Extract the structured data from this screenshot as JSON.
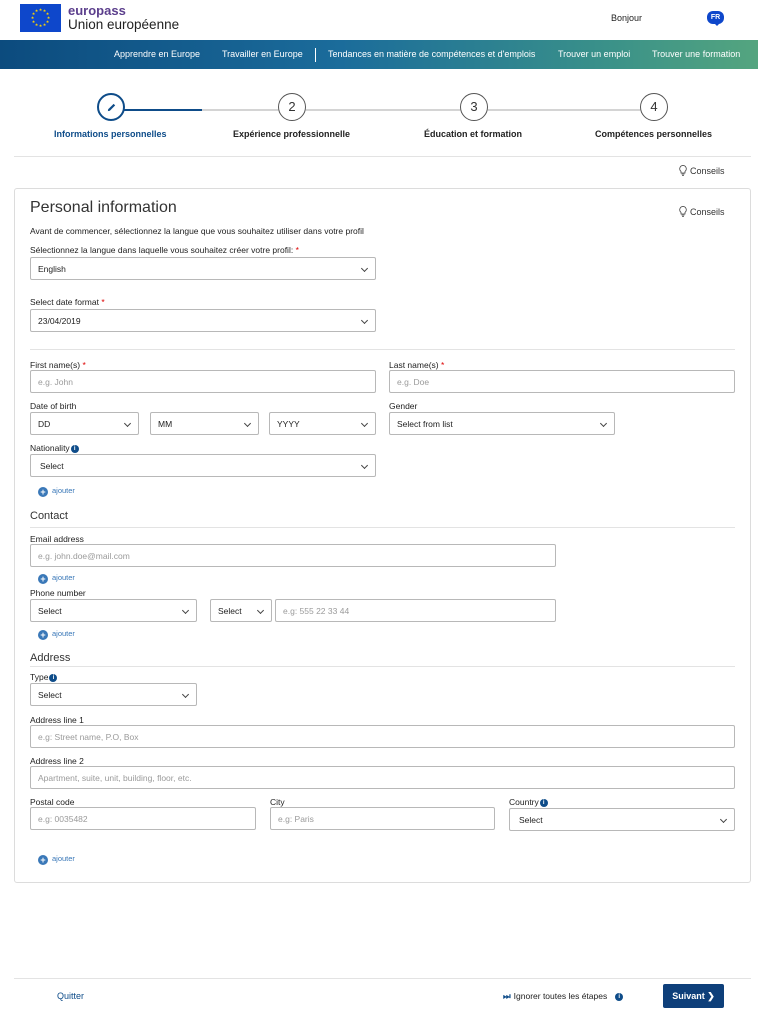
{
  "header": {
    "brand_top": "europass",
    "brand_bottom": "Union européenne",
    "greeting": "Bonjour",
    "language_badge": "FR",
    "logo_icon": "eu-flag-icon"
  },
  "nav": {
    "items": [
      "Apprendre en Europe",
      "Travailler en Europe",
      "Tendances en matière de compétences et d'emplois",
      "Trouver un emploi",
      "Trouver une formation"
    ]
  },
  "stepper": {
    "steps": [
      {
        "number": "",
        "label": "Informations personnelles",
        "icon": "pencil-icon",
        "active": true
      },
      {
        "number": "2",
        "label": "Expérience professionnelle"
      },
      {
        "number": "3",
        "label": "Éducation et formation"
      },
      {
        "number": "4",
        "label": "Compétences personnelles"
      }
    ]
  },
  "tips_label": "Conseils",
  "form": {
    "title": "Personal information",
    "intro": "Avant de commencer, sélectionnez la langue que vous souhaitez utiliser dans votre profil",
    "language_label": "Sélectionnez la langue dans laquelle vous souhaitez créer votre profil:",
    "language_value": "English",
    "date_format_label": "Select date format",
    "date_format_value": "23/04/2019",
    "first_name_label": "First name(s)",
    "first_name_placeholder": "e.g. John",
    "last_name_label": "Last name(s)",
    "last_name_placeholder": "e.g. Doe",
    "dob_label": "Date of birth",
    "dob_day": "DD",
    "dob_month": "MM",
    "dob_year": "YYYY",
    "gender_label": "Gender",
    "gender_value": "Select from list",
    "nationality_label": "Nationality",
    "nationality_value": "Select",
    "add_label": "ajouter",
    "required_mark": "*",
    "info_mark": "i",
    "contact": {
      "title": "Contact",
      "email_label": "Email address",
      "email_placeholder": "e.g. john.doe@mail.com",
      "phone_label": "Phone number",
      "phone_type_value": "Select",
      "phone_code_value": "Select",
      "phone_placeholder": "e.g: 555 22 33 44"
    },
    "address": {
      "title": "Address",
      "type_label": "Type",
      "type_value": "Select",
      "line1_label": "Address line 1",
      "line1_placeholder": "e.g: Street name, P.O, Box",
      "line2_label": "Address line 2",
      "line2_placeholder": "Apartment, suite, unit, building, floor, etc.",
      "postal_label": "Postal code",
      "postal_placeholder": "e.g: 0035482",
      "city_label": "City",
      "city_placeholder": "e.g: Paris",
      "country_label": "Country",
      "country_value": "Select"
    }
  },
  "footer": {
    "quit_label": "Quitter",
    "skip_label": "Ignorer toutes les étapes",
    "next_label": "Suivant"
  },
  "colors": {
    "primary": "#0e4c89",
    "brand_purple": "#5b3e8c",
    "eu_blue": "#0e47cb",
    "required": "#dd0000"
  }
}
